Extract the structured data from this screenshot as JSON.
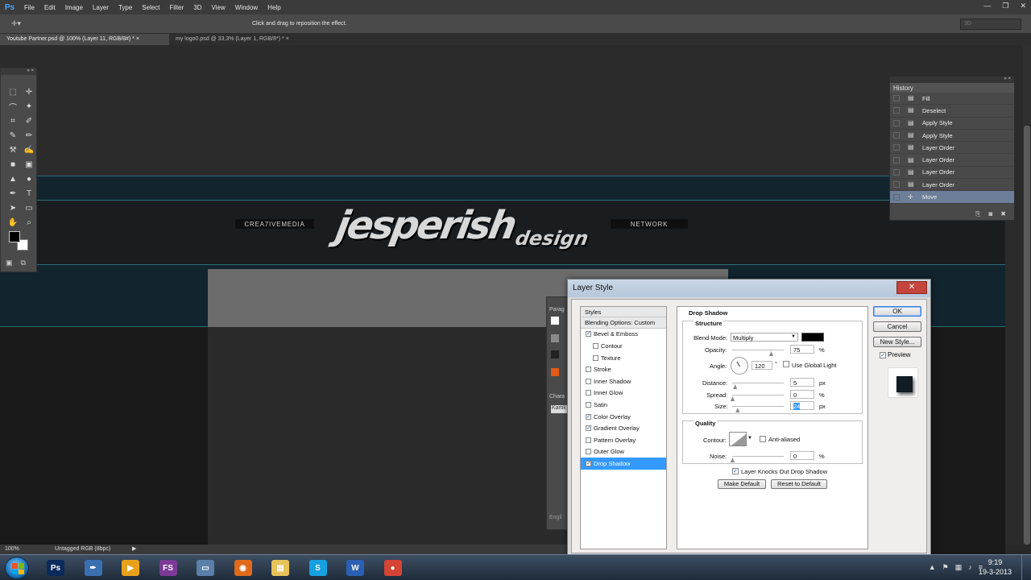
{
  "app": {
    "logo": "Ps",
    "menu": [
      "File",
      "Edit",
      "Image",
      "Layer",
      "Type",
      "Select",
      "Filter",
      "3D",
      "View",
      "Window",
      "Help"
    ],
    "window_controls": {
      "minimize": "—",
      "restore": "❐",
      "close": "✕"
    }
  },
  "options_bar": {
    "tool_icon": "move-tool-icon",
    "hint": "Click and drag to reposition the effect.",
    "workspace": "3D"
  },
  "document_tabs": [
    {
      "label": "Youtube Partner.psd @ 100% (Layer 11, RGB/8#) *",
      "close": "×",
      "active": true
    },
    {
      "label": "my logo0.psd @ 33,3% (Layer 1, RGB/8*) *",
      "close": "×",
      "active": false
    }
  ],
  "artwork": {
    "left_tag": "CREA7IVEMEDIA",
    "right_tag": "NETWORK",
    "logo_main": "jesperish",
    "logo_sub": "design"
  },
  "status_bar": {
    "zoom": "100%",
    "doc_info": "Untagged RGB (8bpc)",
    "arrow": "▶"
  },
  "tools_panel": {
    "collapse": "» ×",
    "tools": [
      "⬚",
      "✛",
      "⌒",
      "✦",
      "⌗",
      "✐",
      "✎",
      "✏",
      "⚒",
      "✍",
      "■",
      "▣",
      "▲",
      "●",
      "✒",
      "T",
      "➤",
      "▭",
      "✋",
      "⌕"
    ],
    "quick_mask": "▣",
    "screen_mode": "⧉"
  },
  "history_panel": {
    "controls": "» ×",
    "title": "History",
    "items": [
      {
        "label": "Fill",
        "icon": "▤",
        "current": false
      },
      {
        "label": "Deselect",
        "icon": "▤",
        "current": false
      },
      {
        "label": "Apply Style",
        "icon": "▤",
        "current": false
      },
      {
        "label": "Apply Style",
        "icon": "▤",
        "current": false
      },
      {
        "label": "Layer Order",
        "icon": "▤",
        "current": false
      },
      {
        "label": "Layer Order",
        "icon": "▤",
        "current": false
      },
      {
        "label": "Layer Order",
        "icon": "▤",
        "current": false
      },
      {
        "label": "Layer Order",
        "icon": "▤",
        "current": false
      },
      {
        "label": "Move",
        "icon": "✛",
        "current": true
      }
    ],
    "footer": [
      "⎘",
      "◙",
      "✖"
    ]
  },
  "side_panels": {
    "paragraph_tab": "Parag",
    "character_tab": "Chara",
    "font_field": "Kartik",
    "english_label": "Engli"
  },
  "layer_style_dialog": {
    "title": "Layer Style",
    "close": "✕",
    "styles_header": "Styles",
    "blending": "Blending Options: Custom",
    "styles": [
      {
        "label": "Bevel & Emboss",
        "checked": true,
        "indent": 1,
        "selected": false
      },
      {
        "label": "Contour",
        "checked": false,
        "indent": 2,
        "selected": false
      },
      {
        "label": "Texture",
        "checked": false,
        "indent": 2,
        "selected": false
      },
      {
        "label": "Stroke",
        "checked": false,
        "indent": 1,
        "selected": false
      },
      {
        "label": "Inner Shadow",
        "checked": false,
        "indent": 1,
        "selected": false
      },
      {
        "label": "Inner Glow",
        "checked": false,
        "indent": 1,
        "selected": false
      },
      {
        "label": "Satin",
        "checked": false,
        "indent": 1,
        "selected": false
      },
      {
        "label": "Color Overlay",
        "checked": true,
        "indent": 1,
        "selected": false
      },
      {
        "label": "Gradient Overlay",
        "checked": true,
        "indent": 1,
        "selected": false
      },
      {
        "label": "Pattern Overlay",
        "checked": false,
        "indent": 1,
        "selected": false
      },
      {
        "label": "Outer Glow",
        "checked": false,
        "indent": 1,
        "selected": false
      },
      {
        "label": "Drop Shadow",
        "checked": true,
        "indent": 1,
        "selected": true
      }
    ],
    "section_title": "Drop Shadow",
    "structure": {
      "title": "Structure",
      "blend_mode_label": "Blend Mode:",
      "blend_mode": "Multiply",
      "shadow_color": "#000000",
      "opacity_label": "Opacity:",
      "opacity": "75",
      "opacity_fraction": 0.75,
      "percent": "%",
      "angle_label": "Angle:",
      "angle": "120",
      "degree": "°",
      "use_global_light": "Use Global Light",
      "distance_label": "Distance:",
      "distance": "5",
      "distance_fraction": 0.05,
      "spread_label": "Spread:",
      "spread": "0",
      "spread_fraction": 0.0,
      "size_label": "Size:",
      "size": "24",
      "size_fraction": 0.1,
      "px": "px"
    },
    "quality": {
      "title": "Quality",
      "contour_label": "Contour:",
      "anti_aliased": "Anti-aliased",
      "noise_label": "Noise:",
      "noise": "0",
      "noise_fraction": 0.0
    },
    "knocks_out": "Layer Knocks Out Drop Shadow",
    "make_default": "Make Default",
    "reset_default": "Reset to Default",
    "buttons": {
      "ok": "OK",
      "cancel": "Cancel",
      "new_style": "New Style..."
    },
    "preview_label": "Preview",
    "check": "✓"
  },
  "taskbar": {
    "apps": [
      {
        "name": "photoshop",
        "label": "Ps",
        "color": "#0a2a5a"
      },
      {
        "name": "pen-app",
        "label": "✒",
        "color": "#3a6fb0"
      },
      {
        "name": "media-player",
        "label": "▶",
        "color": "#e8a11c"
      },
      {
        "name": "fs-app",
        "label": "FS",
        "color": "#7a3a96"
      },
      {
        "name": "monitor-app",
        "label": "▭",
        "color": "#5a7fa8"
      },
      {
        "name": "firefox",
        "label": "◉",
        "color": "#e06a1b"
      },
      {
        "name": "explorer",
        "label": "▤",
        "color": "#e8c35a"
      },
      {
        "name": "skype",
        "label": "S",
        "color": "#16a0e0"
      },
      {
        "name": "word",
        "label": "W",
        "color": "#2b5fb4"
      },
      {
        "name": "chrome",
        "label": "●",
        "color": "#d64436"
      }
    ],
    "tray": [
      "▲",
      "⚑",
      "▦",
      "♪",
      "≡"
    ],
    "time": "9:19",
    "date": "19-3-2013"
  }
}
